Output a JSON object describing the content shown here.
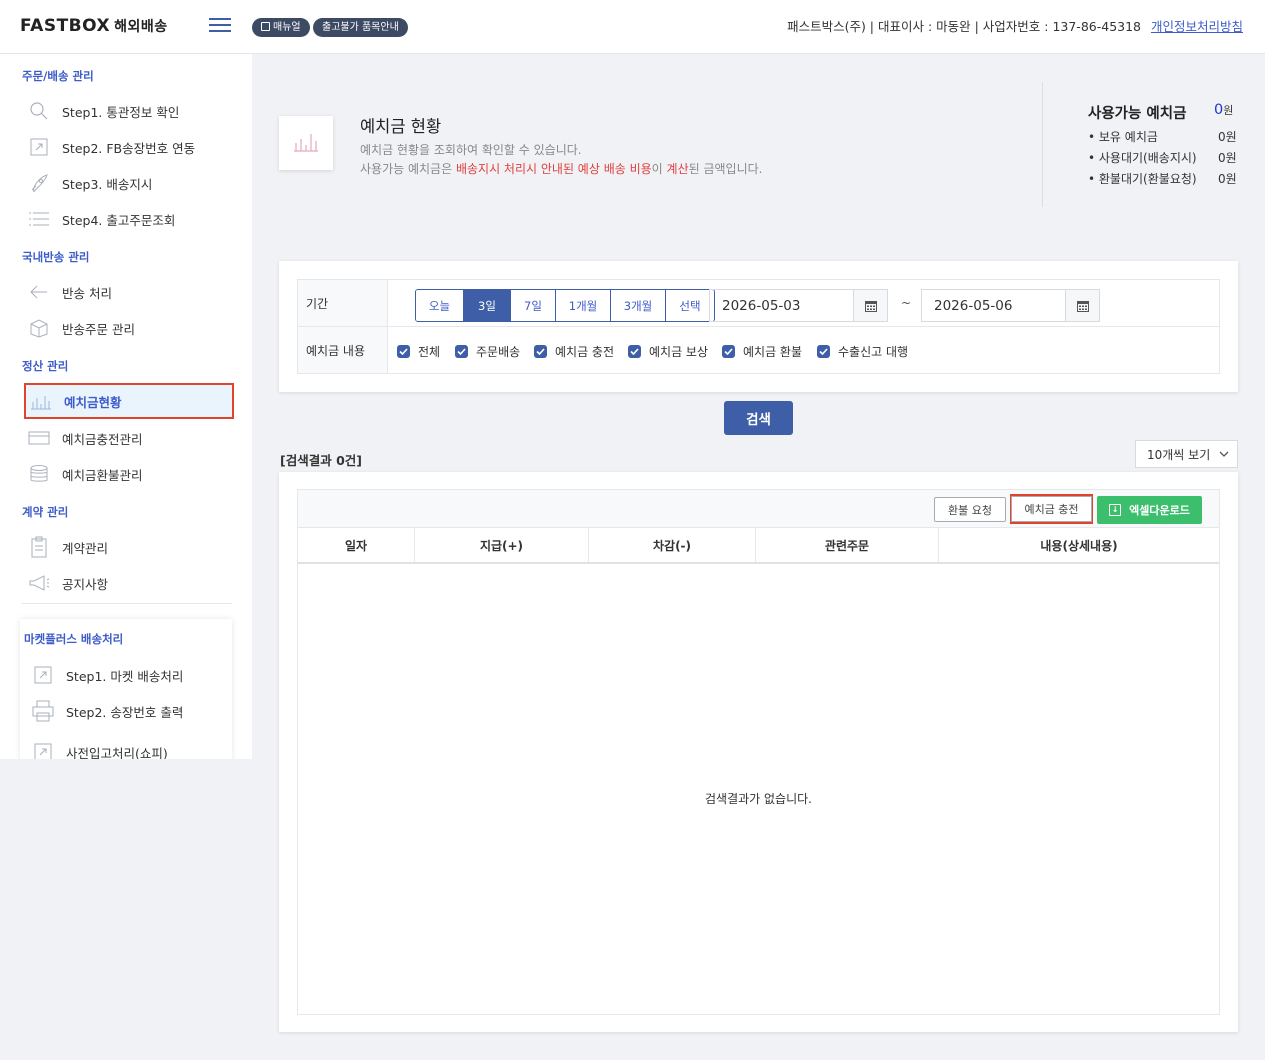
{
  "header": {
    "logo": "FASTBOX",
    "logo_sub": "해외배송",
    "pill_manual": "매뉴얼",
    "pill_unshippable": "출고불가 품목안내",
    "company_info": "패스트박스(주) | 대표이사 : 마동완 | 사업자번호 : 137-86-45318",
    "privacy_link": "개인정보처리방침"
  },
  "sidebar": {
    "sections": [
      {
        "title": "주문/배송 관리"
      },
      {
        "title": "국내반송 관리"
      },
      {
        "title": "정산 관리"
      },
      {
        "title": "계약 관리"
      },
      {
        "title": "마켓플러스 배송처리"
      }
    ],
    "items": [
      {
        "label": "Step1. 통관정보 확인",
        "icon": "search-icon"
      },
      {
        "label": "Step2. FB송장번호 연동",
        "icon": "link-icon"
      },
      {
        "label": "Step3. 배송지시",
        "icon": "rocket-icon"
      },
      {
        "label": "Step4. 출고주문조회",
        "icon": "list-icon"
      },
      {
        "label": "반송 처리",
        "icon": "return-arrow-icon"
      },
      {
        "label": "반송주문 관리",
        "icon": "box-icon"
      },
      {
        "label": "예치금현황",
        "icon": "bar-chart-icon",
        "active": true
      },
      {
        "label": "예치금충전관리",
        "icon": "card-icon"
      },
      {
        "label": "예치금환불관리",
        "icon": "coins-icon"
      },
      {
        "label": "계약관리",
        "icon": "clipboard-icon"
      },
      {
        "label": "공지사항",
        "icon": "megaphone-icon"
      },
      {
        "label": "Step1. 마켓 배송처리",
        "icon": "link-icon"
      },
      {
        "label": "Step2. 송장번호 출력",
        "icon": "printer-icon"
      },
      {
        "label": "사전입고처리(쇼피)",
        "icon": "link-icon"
      }
    ]
  },
  "info": {
    "title": "예치금 현황",
    "desc1": "예치금 현황을 조회하여 확인할 수 있습니다.",
    "desc2_a": "사용가능 예치금은 ",
    "desc2_red1": "배송지시 처리시 안내된 예상 배송 비용",
    "desc2_b": "이 ",
    "desc2_red2": "계산",
    "desc2_c": "된 금액입니다."
  },
  "balance": {
    "title": "사용가능 예치금",
    "main_value": "0",
    "main_unit": "원",
    "rows": [
      {
        "label": "• 보유 예치금",
        "value": "0원"
      },
      {
        "label": "• 사용대기(배송지시)",
        "value": "0원"
      },
      {
        "label": "• 환불대기(환불요청)",
        "value": "0원"
      }
    ]
  },
  "filter": {
    "period_label": "기간",
    "period_options": [
      "오늘",
      "3일",
      "7일",
      "1개월",
      "3개월",
      "선택"
    ],
    "period_selected": "3일",
    "date_from": "2026-05-03",
    "date_to": "2026-05-06",
    "tilde": "~",
    "content_label": "예치금 내용",
    "checkboxes": [
      "전체",
      "주문배송",
      "예치금 충전",
      "예치금 보상",
      "예치금 환불",
      "수출신고 대행"
    ]
  },
  "search_button": "검색",
  "result_count": "[검색결과 0건]",
  "page_size": "10개씩 보기",
  "toolbar": {
    "refund": "환불 요청",
    "charge": "예치금 충전",
    "excel": "엑셀다운로드"
  },
  "table": {
    "columns": [
      "일자",
      "지급(+)",
      "차감(-)",
      "관련주문",
      "내용(상세내용)"
    ],
    "empty_message": "검색결과가 없습니다."
  },
  "colors": {
    "primary": "#3e5fa8",
    "link": "#3d5cc9",
    "highlight": "#e0452c",
    "excel": "#3bbf6d",
    "warning_text": "#e04040"
  }
}
